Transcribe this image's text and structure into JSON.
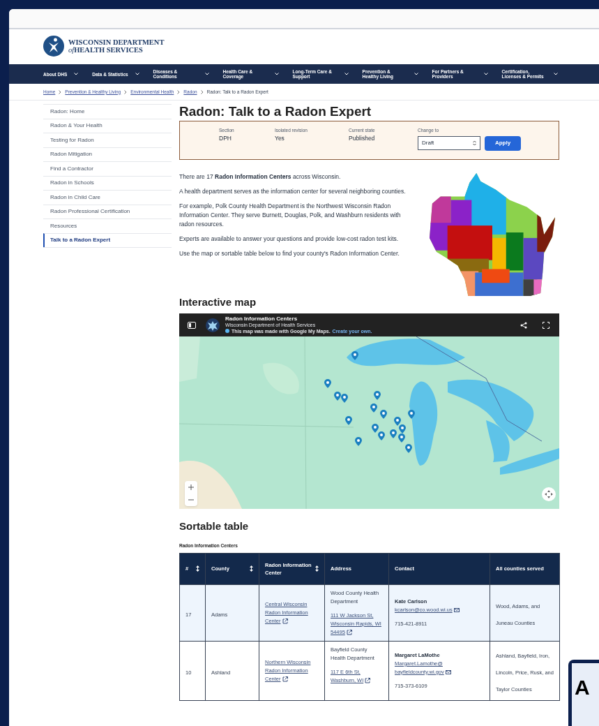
{
  "header": {
    "logo_line1": "WISCONSIN DEPARTMENT",
    "logo_line2_em": "of",
    "logo_line2": "HEALTH SERVICES"
  },
  "nav": [
    {
      "label": "About DHS"
    },
    {
      "label": "Data & Statistics"
    },
    {
      "label": "Diseases & Conditions"
    },
    {
      "label": "Health Care & Coverage"
    },
    {
      "label": "Long-Term Care & Support"
    },
    {
      "label": "Prevention & Healthy Living"
    },
    {
      "label": "For Partners & Providers"
    },
    {
      "label": "Certification, Licenses & Permits"
    }
  ],
  "breadcrumbs": [
    {
      "label": "Home",
      "link": true
    },
    {
      "label": "Prevention & Healthy Living",
      "link": true
    },
    {
      "label": "Environmental Health",
      "link": true
    },
    {
      "label": "Radon",
      "link": true
    },
    {
      "label": "Radon: Talk to a Radon Expert",
      "link": false
    }
  ],
  "sidebar": {
    "items": [
      {
        "label": "Radon: Home",
        "selected": false
      },
      {
        "label": "Radon & Your Health",
        "selected": false
      },
      {
        "label": "Testing for Radon",
        "selected": false
      },
      {
        "label": "Radon Mitigation",
        "selected": false
      },
      {
        "label": "Find a Contractor",
        "selected": false
      },
      {
        "label": "Radon in Schools",
        "selected": false
      },
      {
        "label": "Radon in Child Care",
        "selected": false
      },
      {
        "label": "Radon Professional Certification",
        "selected": false
      },
      {
        "label": "Resources",
        "selected": false
      },
      {
        "label": "Talk to a Radon Expert",
        "selected": true
      }
    ]
  },
  "page_title": "Radon: Talk to a Radon Expert",
  "moderation": {
    "fields": [
      {
        "label": "Section",
        "value": "DPH"
      },
      {
        "label": "Isolated revision",
        "value": "Yes"
      },
      {
        "label": "Current state",
        "value": "Published"
      }
    ],
    "change_to": {
      "label": "Change to",
      "value": "Draft"
    },
    "apply_button": "Apply"
  },
  "intro": [
    "There are 17 **Radon Information Centers** across Wisconsin.",
    "A health department serves as the information center for several neighboring counties.",
    "For example, Polk County Health Department is the Northwest Wisconsin Radon Information Center. They serve Burnett, Douglas, Polk, and Washburn residents with radon resources.",
    "Experts are available to answer your questions and provide low-cost radon test kits.",
    "Use the map or sortable table below to find your county's Radon Information Center."
  ],
  "map_section": {
    "heading": "Interactive map",
    "title": "Radon Information Centers",
    "subtitle": "Wisconsin Department of Health Services",
    "notice": "This map was made with Google My Maps.",
    "notice_link": "Create your own."
  },
  "table_section": {
    "heading": "Sortable table",
    "caption": "Radon Information Centers",
    "columns": [
      {
        "label": "#",
        "sortable": true
      },
      {
        "label": "County",
        "sortable": true
      },
      {
        "label": "Radon Information Center",
        "sortable": true
      },
      {
        "label": "Address",
        "sortable": false
      },
      {
        "label": "Contact",
        "sortable": false
      },
      {
        "label": "All counties served",
        "sortable": false
      }
    ],
    "rows": [
      {
        "number": "17",
        "county": "Adams",
        "center": "Central Wisconsin Radon Information Center",
        "agency": "Wood County Health Department",
        "address": "111 W Jackson St, Wisconsin Rapids, WI 54495",
        "contact_name": "Kate Carlson",
        "email": "kcarlson@co.wood.wi.us",
        "phone": "715-421-8911",
        "counties": "Wood, Adams, and Juneau Counties"
      },
      {
        "number": "10",
        "county": "Ashland",
        "center": "Northern Wisconsin Radon Information Center",
        "agency": "Bayfield County Health Department",
        "address": "117 E 6th St, Washburn, WI",
        "contact_name": "Margaret LaMothe",
        "email": "Margaret.Lamothe@ bayfieldcounty.wi.gov",
        "phone": "715-373-6109",
        "counties": "Ashland, Bayfield, Iron, Lincoln, Price, Rusk, and Taylor Counties"
      }
    ]
  },
  "widget": {
    "label": "A"
  }
}
